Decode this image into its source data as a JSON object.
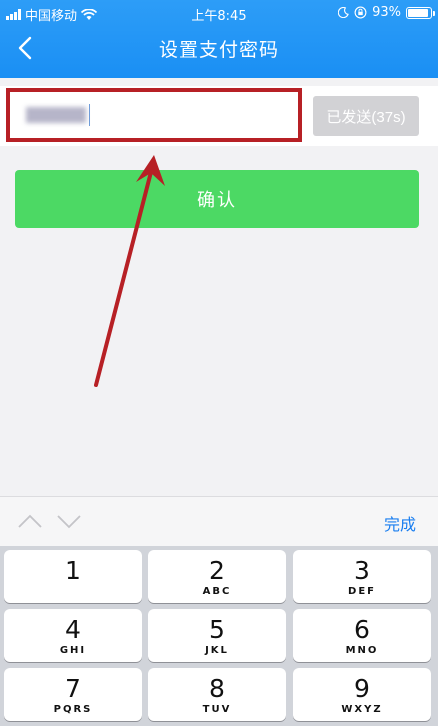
{
  "status_bar": {
    "carrier": "中国移动",
    "time": "上午8:45",
    "battery": "93%",
    "battery_level": 0.93,
    "icons": [
      "signal-icon",
      "wifi-icon",
      "moon-icon",
      "orientation-lock-icon",
      "battery-icon"
    ]
  },
  "nav": {
    "title": "设置支付密码",
    "back_icon": "back-chevron-icon"
  },
  "form": {
    "code_value": "",
    "resend_label": "已发送(37s)",
    "confirm_label": "确认"
  },
  "accessory_bar": {
    "done_label": "完成",
    "icons": [
      "chevron-up-icon",
      "chevron-down-icon"
    ]
  },
  "keypad": {
    "keys": [
      {
        "num": "1",
        "letters": ""
      },
      {
        "num": "2",
        "letters": "ABC"
      },
      {
        "num": "3",
        "letters": "DEF"
      },
      {
        "num": "4",
        "letters": "GHI"
      },
      {
        "num": "5",
        "letters": "JKL"
      },
      {
        "num": "6",
        "letters": "MNO"
      },
      {
        "num": "7",
        "letters": "PQRS"
      },
      {
        "num": "8",
        "letters": "TUV"
      },
      {
        "num": "9",
        "letters": "WXYZ"
      }
    ]
  },
  "colors": {
    "header_blue": "#1a8ff4",
    "confirm_green": "#4cd964",
    "annotation_red": "#b72025",
    "done_blue": "#1a7ef0"
  }
}
